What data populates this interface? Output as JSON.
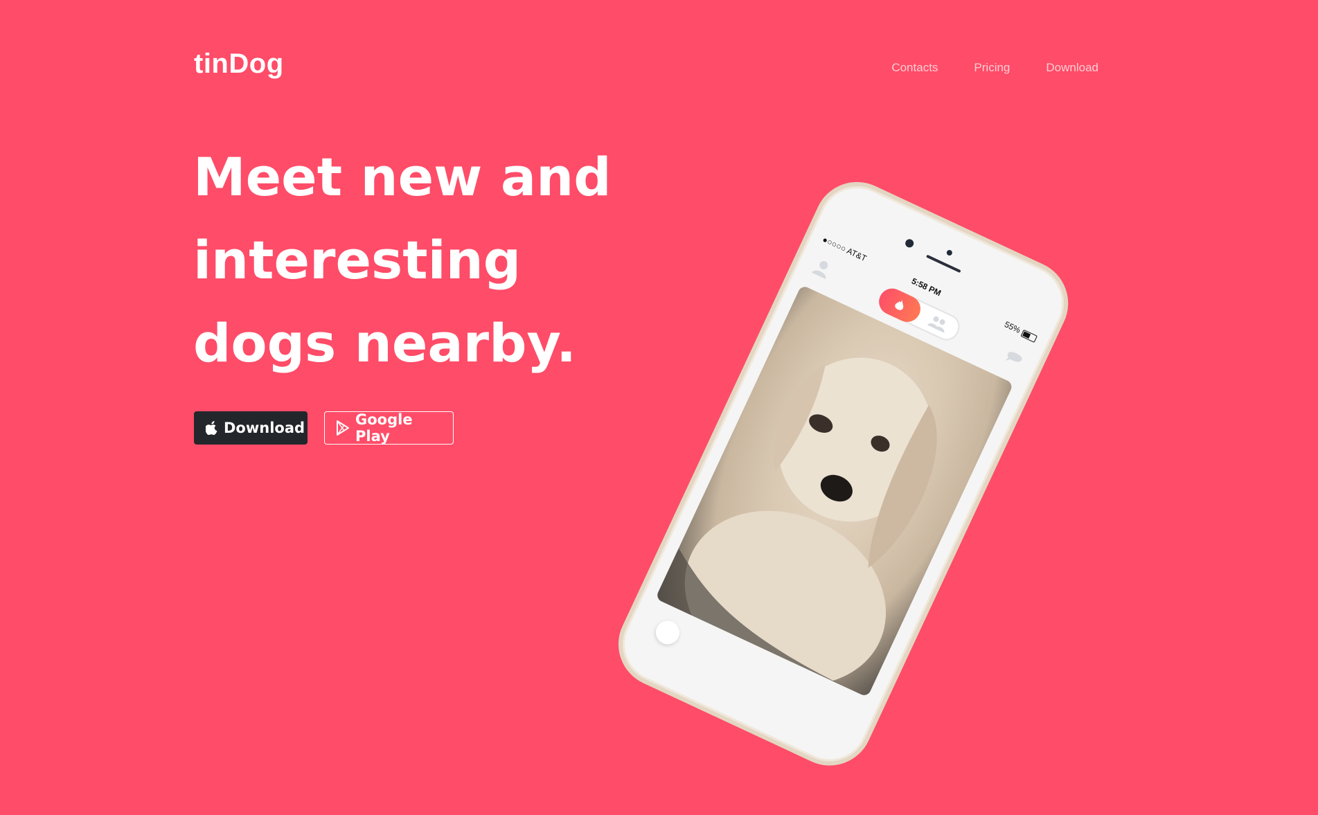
{
  "navbar": {
    "brand": "tinDog",
    "links": [
      "Contacts",
      "Pricing",
      "Download"
    ]
  },
  "hero": {
    "title_lines": [
      "Meet new and",
      "interesting",
      "dogs nearby."
    ],
    "buttons": {
      "apple_label": "Download",
      "google_label": "Google Play"
    }
  },
  "phone": {
    "carrier": "●○○○○ AT&T",
    "time": "5:58 PM",
    "battery": "55%"
  },
  "colors": {
    "background": "#ff4c68",
    "dark_button": "#23272b",
    "text": "#ffffff"
  },
  "icons": {
    "apple": "apple-icon",
    "google_play": "google-play-icon",
    "flame": "flame-icon",
    "group": "group-icon",
    "profile": "profile-icon",
    "chat": "chat-icon"
  }
}
